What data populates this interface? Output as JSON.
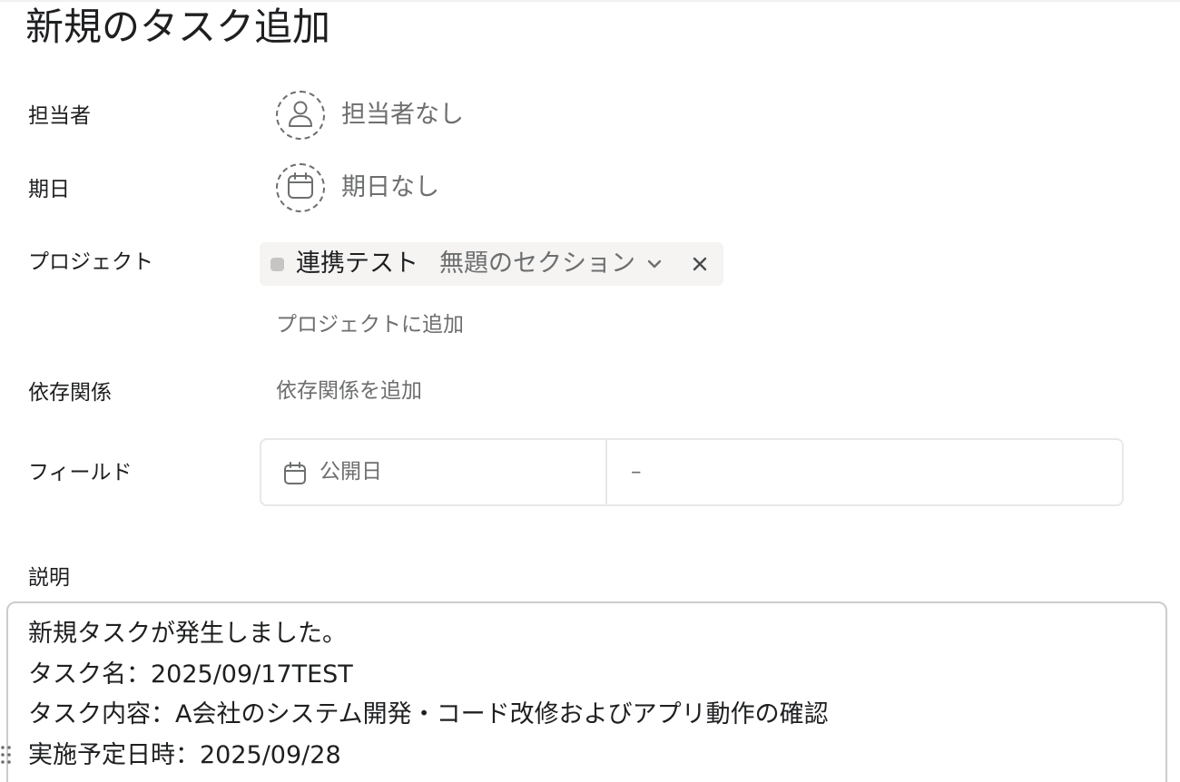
{
  "dialog": {
    "title": "新規のタスク追加"
  },
  "fields": {
    "assignee": {
      "label": "担当者",
      "value": "担当者なし",
      "icon": "person-icon"
    },
    "due_date": {
      "label": "期日",
      "value": "期日なし",
      "icon": "calendar-icon"
    },
    "project": {
      "label": "プロジェクト",
      "project_name": "連携テスト",
      "section_name": "無題のセクション",
      "add_link": "プロジェクトに追加",
      "color": "#c7c4c4"
    },
    "dependencies": {
      "label": "依存関係",
      "add_link": "依存関係を追加"
    },
    "custom_fields": {
      "label": "フィールド",
      "rows": [
        {
          "name": "公開日",
          "value": "–",
          "icon": "calendar-icon"
        }
      ]
    }
  },
  "description": {
    "label": "説明",
    "lines": [
      "新規タスクが発生しました。",
      "タスク名：2025/09/17TEST",
      "タスク内容：A会社のシステム開発・コード改修およびアプリ動作の確認",
      "実施予定日時：2025/09/28"
    ]
  },
  "colors": {
    "text_primary": "#1e1f21",
    "text_secondary": "#6d6e6f",
    "pill_background": "#f5f4f3",
    "border": "#e8e8e8"
  }
}
